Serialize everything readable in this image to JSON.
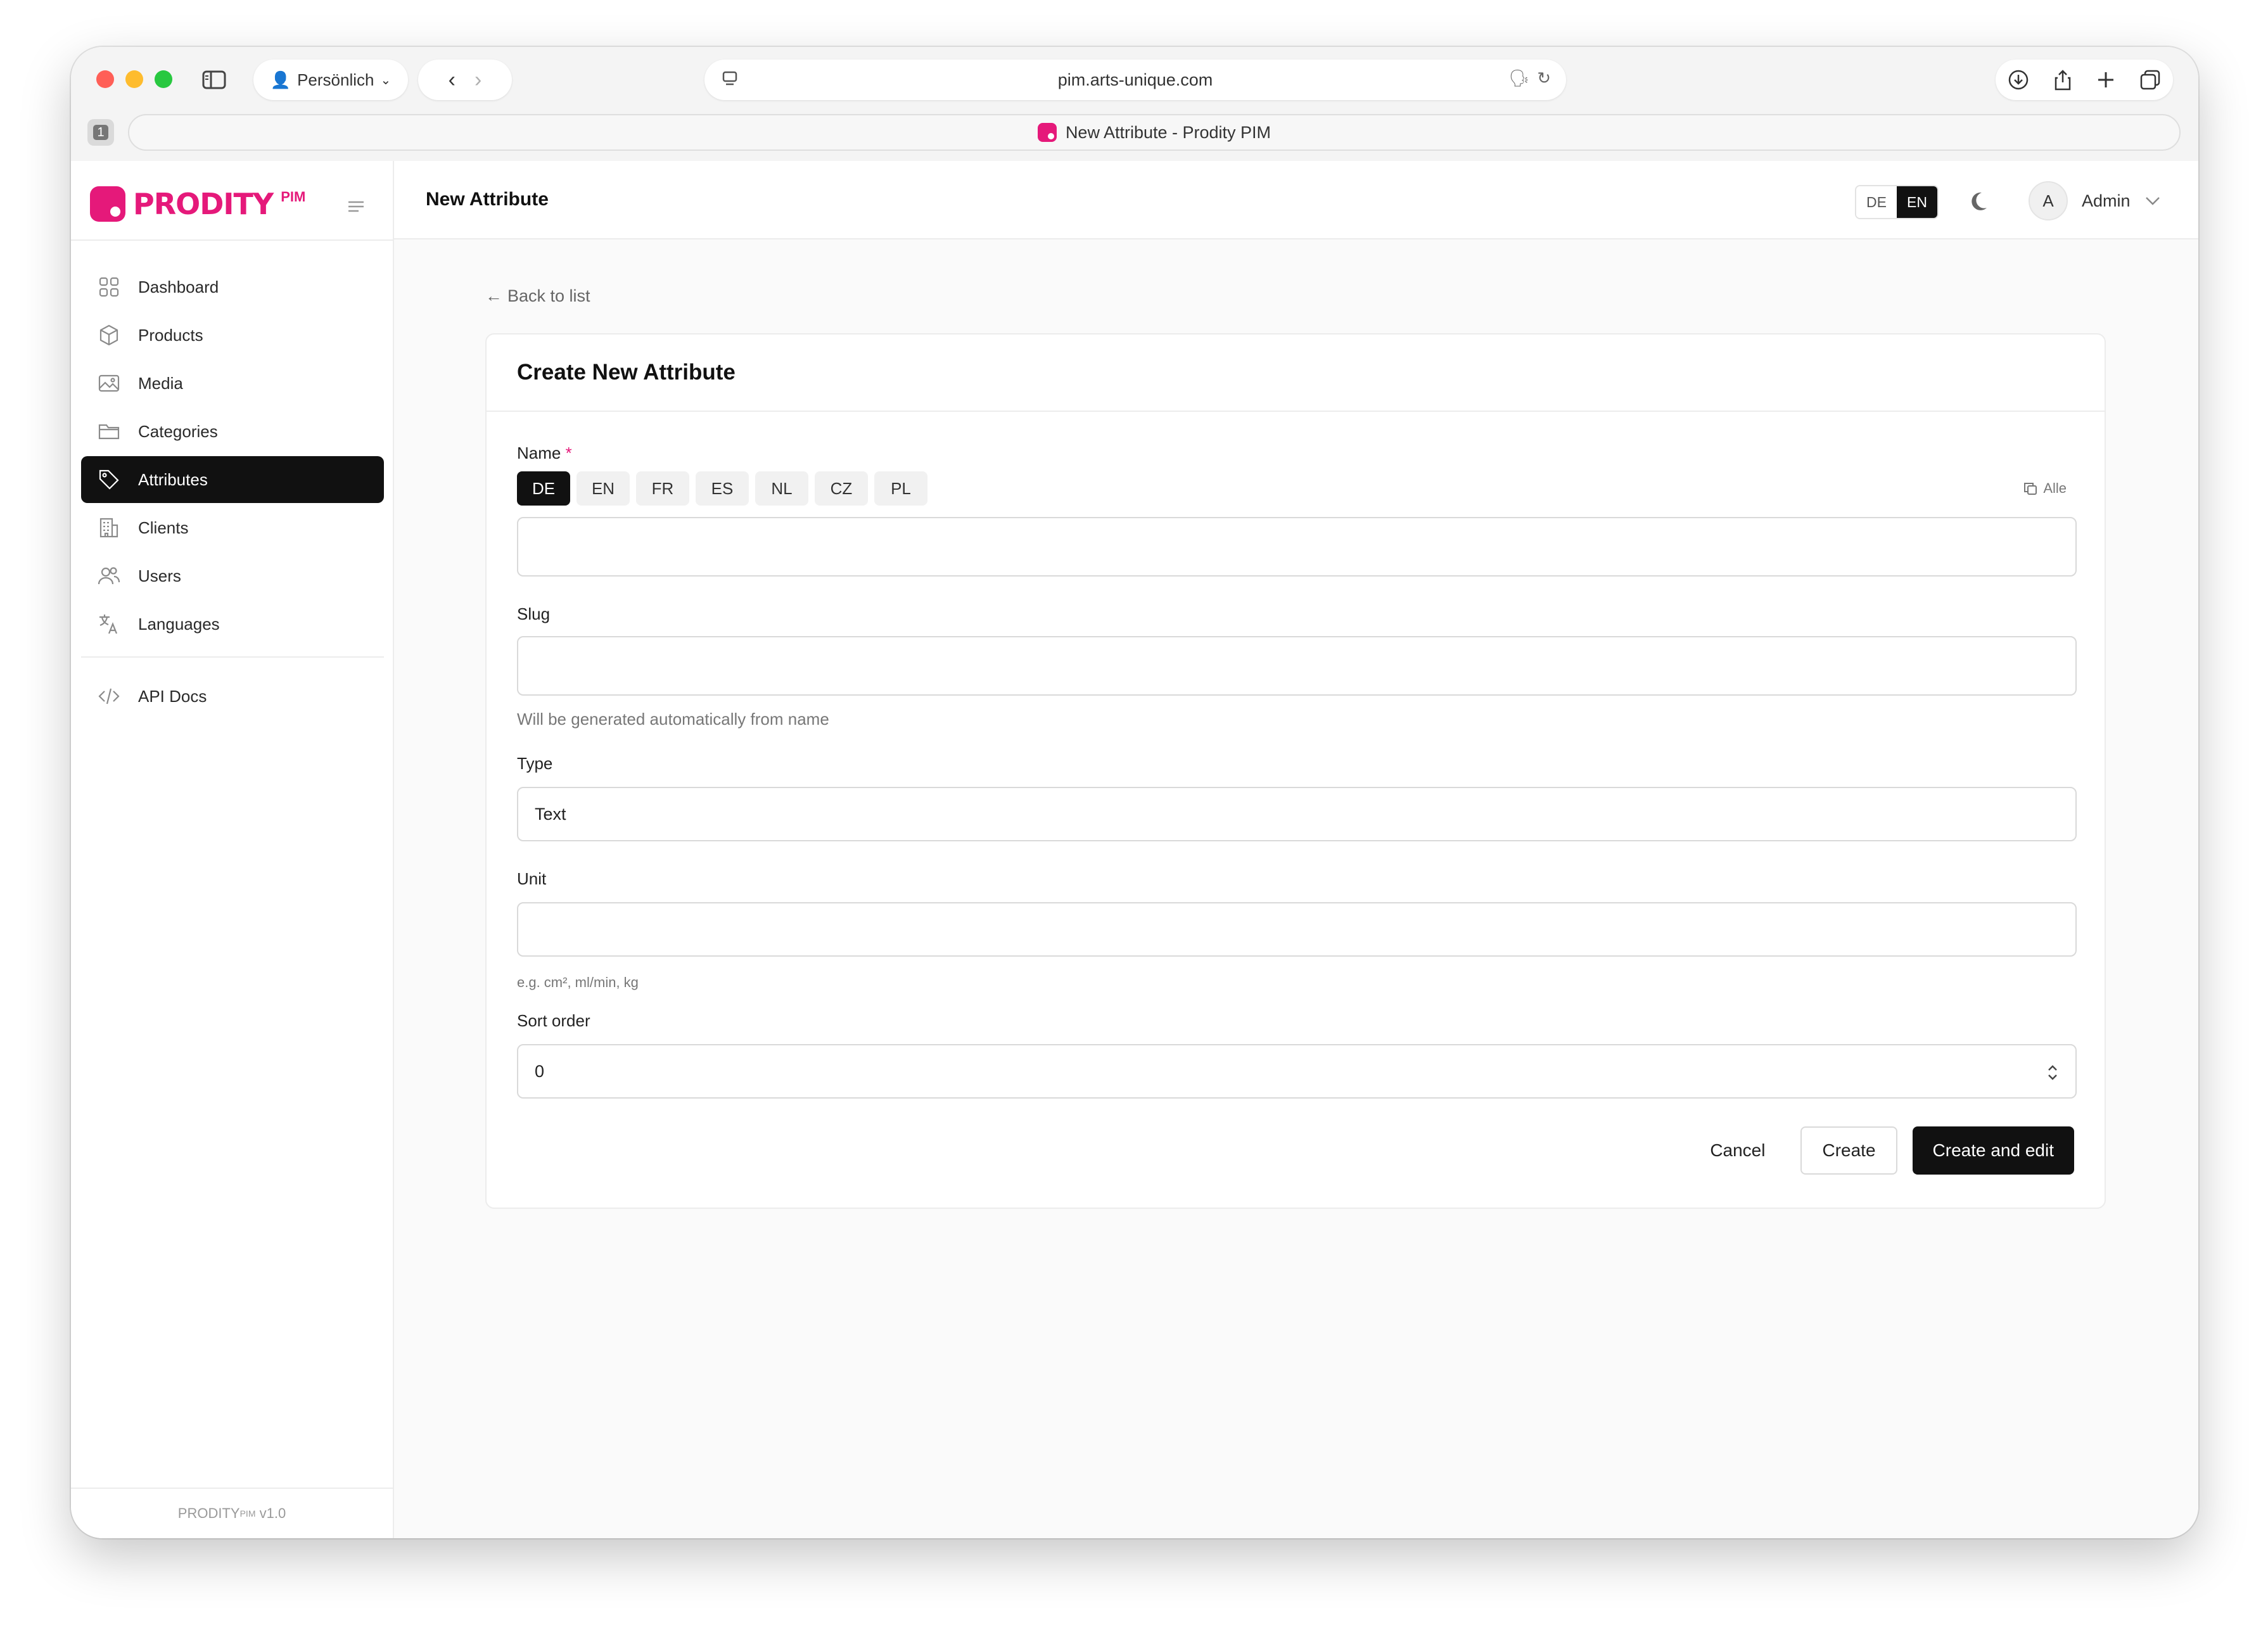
{
  "browser": {
    "profile_label": "Persönlich",
    "url": "pim.arts-unique.com",
    "tab_title": "New Attribute - Prodity PIM",
    "tab_count": "1"
  },
  "brand": {
    "logo_text": "PRODITY",
    "logo_sup": "PIM",
    "accent_color": "#e5197a",
    "footer_name": "PRODITY",
    "footer_sup": "PIM",
    "footer_version": "v1.0"
  },
  "sidebar": {
    "items": [
      {
        "label": "Dashboard",
        "icon": "grid-icon"
      },
      {
        "label": "Products",
        "icon": "box-icon"
      },
      {
        "label": "Media",
        "icon": "image-icon"
      },
      {
        "label": "Categories",
        "icon": "folder-icon"
      },
      {
        "label": "Attributes",
        "icon": "tag-icon",
        "active": true
      },
      {
        "label": "Clients",
        "icon": "building-icon"
      },
      {
        "label": "Users",
        "icon": "users-icon"
      },
      {
        "label": "Languages",
        "icon": "translate-icon"
      }
    ],
    "secondary": [
      {
        "label": "API Docs",
        "icon": "code-icon"
      }
    ]
  },
  "header": {
    "title": "New Attribute",
    "languages": [
      "DE",
      "EN"
    ],
    "active_language": "EN",
    "user_initial": "A",
    "user_name": "Admin"
  },
  "main": {
    "back_label": "Back to list",
    "card_title": "Create New Attribute",
    "name_label": "Name",
    "required_mark": "*",
    "name_langs": [
      "DE",
      "EN",
      "FR",
      "ES",
      "NL",
      "CZ",
      "PL"
    ],
    "name_active_lang": "DE",
    "copy_all_label": "Alle",
    "name_value": "",
    "slug_label": "Slug",
    "slug_value": "",
    "slug_hint": "Will be generated automatically from name",
    "type_label": "Type",
    "type_value": "Text",
    "unit_label": "Unit",
    "unit_value": "",
    "unit_hint": "e.g. cm², ml/min, kg",
    "sort_label": "Sort order",
    "sort_value": "0",
    "cancel_label": "Cancel",
    "create_label": "Create",
    "create_edit_label": "Create and edit"
  }
}
